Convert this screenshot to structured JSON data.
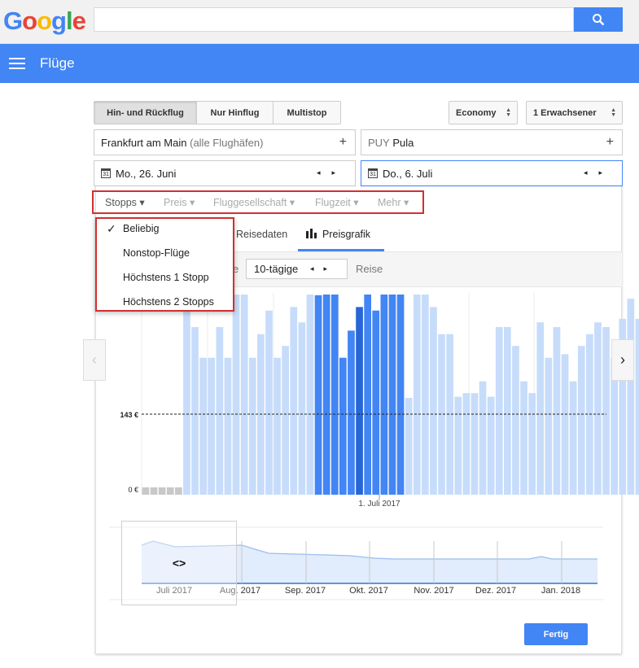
{
  "header": {
    "logo": "Google",
    "app_title": "Flüge"
  },
  "trip_types": [
    "Hin- und Rückflug",
    "Nur Hinflug",
    "Multistop"
  ],
  "cabin_class": "Economy",
  "passengers": "1 Erwachsener",
  "origin": {
    "city": "Frankfurt am Main",
    "detail": "(alle Flughäfen)"
  },
  "destination": {
    "code": "PUY",
    "city": "Pula"
  },
  "depart_date": "Mo., 26. Juni",
  "return_date": "Do., 6. Juli",
  "filters": [
    "Stopps",
    "Preis",
    "Fluggesellschaft",
    "Flugzeit",
    "Mehr"
  ],
  "stops_menu": [
    "Beliebig",
    "Nonstop-Flüge",
    "Höchstens 1 Stopp",
    "Höchstens 2 Stopps"
  ],
  "stops_selected": "Beliebig",
  "tabs": [
    "Reisedaten",
    "Preisgrafik"
  ],
  "duration_select": "10-tägige",
  "duration_suffix": "Reise",
  "done_button": "Fertig",
  "colors": {
    "accent": "#4285f4",
    "bar_light": "#c6dcfa",
    "bar_mid": "#4285f4",
    "bar_dark": "#2866d6",
    "highlight": "#d32f2f"
  },
  "chart_data": {
    "type": "bar",
    "price_label": "143 €",
    "zero_label": "0 €",
    "date_label": "1. Juli 2017",
    "values": [
      0,
      0,
      0,
      0,
      0,
      176,
      159,
      133,
      133,
      159,
      133,
      196,
      202,
      133,
      153,
      173,
      133,
      143,
      176,
      163,
      209,
      186,
      202,
      222,
      133,
      156,
      176,
      206,
      173,
      212,
      222,
      216,
      99,
      199,
      212,
      176,
      153,
      153,
      100,
      103,
      103,
      113,
      100,
      159,
      159,
      143,
      113,
      103,
      163,
      133,
      159,
      136,
      113,
      143,
      153,
      163,
      159,
      133,
      166,
      183,
      166,
      159,
      133,
      133
    ],
    "timeline_months": [
      "Juli 2017",
      "Aug. 2017",
      "Sep. 2017",
      "Okt. 2017",
      "Nov. 2017",
      "Dez. 2017",
      "Jan. 2018"
    ]
  }
}
